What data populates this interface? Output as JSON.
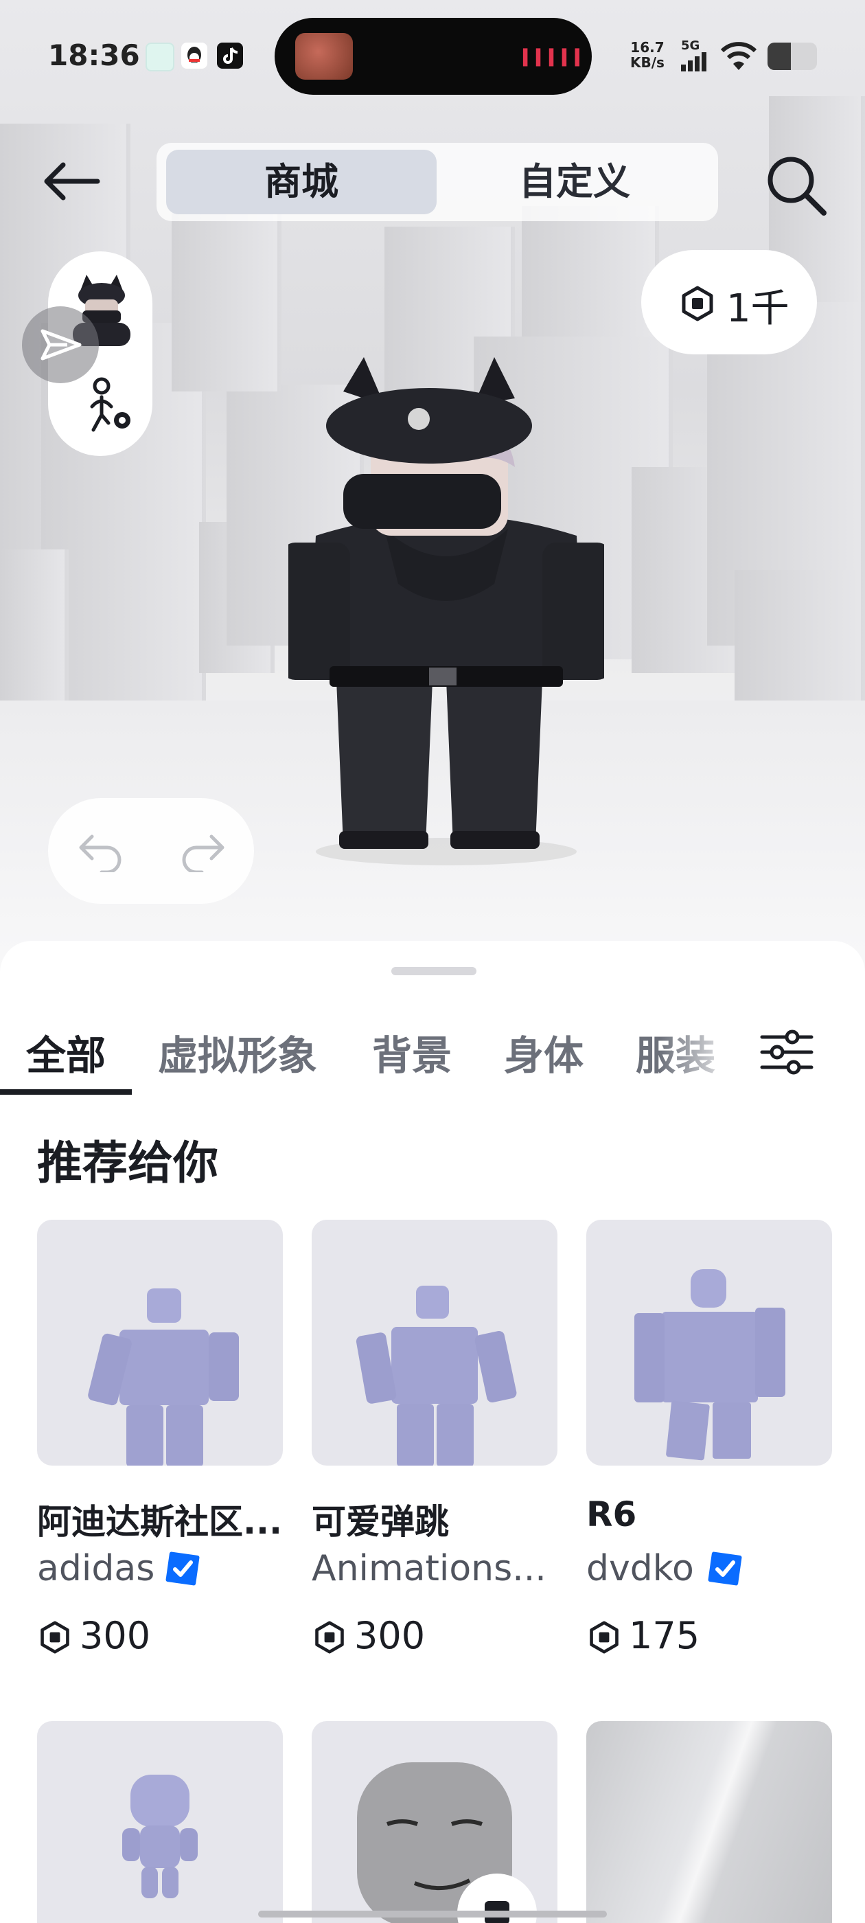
{
  "status_bar": {
    "time": "18:36",
    "speed_value": "16.7",
    "speed_unit": "KB/s",
    "network": "5G",
    "app_icons": [
      "message-app-icon",
      "qq-icon",
      "tiktok-icon"
    ]
  },
  "header": {
    "tabs": [
      {
        "label": "商城",
        "selected": true
      },
      {
        "label": "自定义",
        "selected": false
      }
    ],
    "robux_balance": "1千"
  },
  "categories": [
    {
      "label": "全部",
      "active": true
    },
    {
      "label": "虚拟形象",
      "active": false
    },
    {
      "label": "背景",
      "active": false
    },
    {
      "label": "身体",
      "active": false
    },
    {
      "label": "服装",
      "active": false
    }
  ],
  "section_title": "推荐给你",
  "items": [
    {
      "name": "阿迪达斯社区...",
      "creator": "adidas",
      "verified": true,
      "price": "300"
    },
    {
      "name": "可爱弹跳",
      "creator": "Animations...",
      "verified": false,
      "price": "300"
    },
    {
      "name": "R6",
      "creator": "dvdko",
      "verified": true,
      "price": "175"
    }
  ],
  "colors": {
    "accent_blue": "#0a6cff",
    "selected_tab": "#d7dbe4",
    "card_bg": "#e6e6ec",
    "avatar_preview": "#a8aad8"
  }
}
